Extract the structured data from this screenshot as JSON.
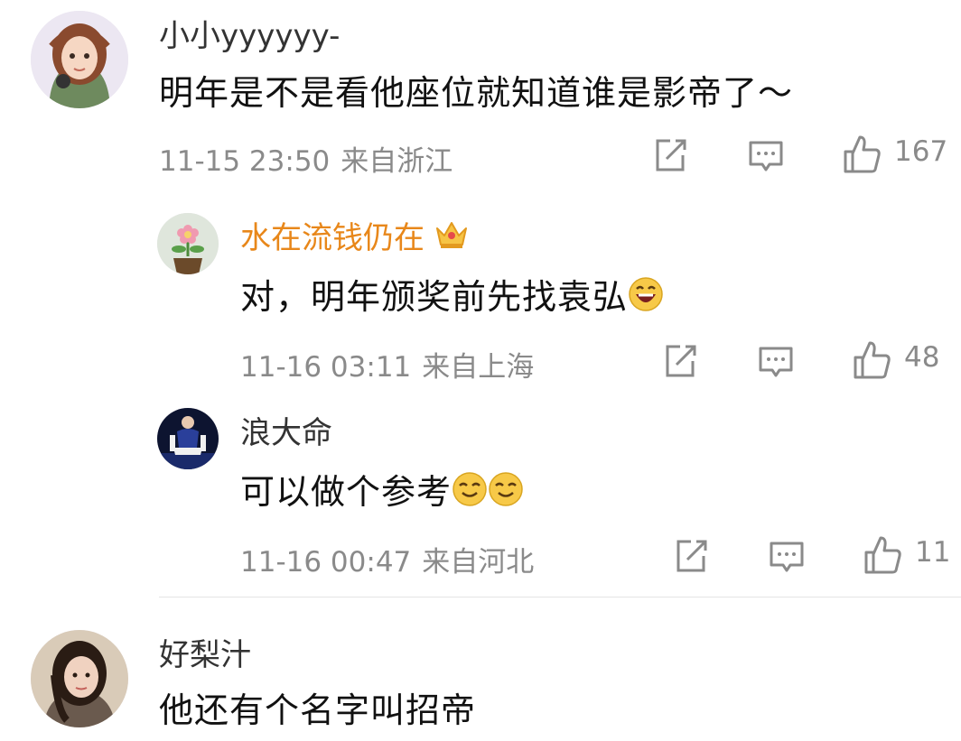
{
  "comments": [
    {
      "username": "小小yyyyyy-",
      "text": "明年是不是看他座位就知道谁是影帝了～",
      "time": "11-15 23:50",
      "location": "来自浙江",
      "likes": "167",
      "avatar_icon": "anime-girl-avatar"
    },
    {
      "username": "水在流钱仍在",
      "vip_icon": "crown-icon",
      "text": "对，明年颁奖前先找袁弘",
      "emoji": "laughing-emoji",
      "time": "11-16 03:11",
      "location": "来自上海",
      "likes": "48",
      "avatar_icon": "flower-pot-avatar"
    },
    {
      "username": "浪大命",
      "text": "可以做个参考",
      "emoji": "smiling-emoji x2",
      "time": "11-16 00:47",
      "location": "来自河北",
      "likes": "11",
      "avatar_icon": "person-avatar"
    },
    {
      "username": "好梨汁",
      "text": "他还有个名字叫招帝",
      "avatar_icon": "woman-avatar"
    }
  ],
  "colors": {
    "vip_name": "#e8871a",
    "meta_text": "#8a8a8a",
    "content_text": "#111111"
  }
}
